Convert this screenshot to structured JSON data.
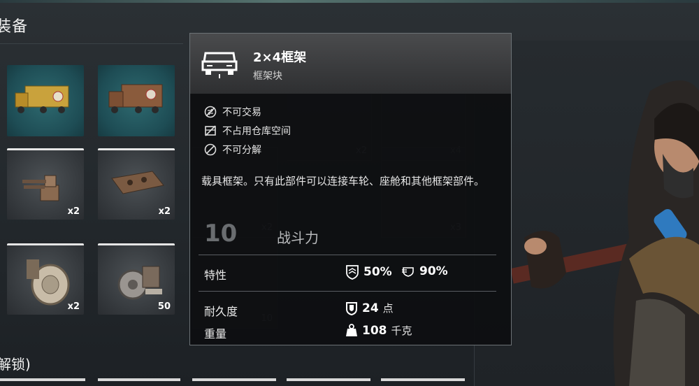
{
  "header": {
    "title": "装备"
  },
  "section": {
    "title": "解锁)"
  },
  "inventory": {
    "slots": [
      {
        "name": "truck-yellow",
        "count": ""
      },
      {
        "name": "truck-brown",
        "count": ""
      },
      {
        "name": "turret",
        "count": "x2"
      },
      {
        "name": "frame-part",
        "count": "x2"
      },
      {
        "name": "wheel",
        "count": "x2"
      },
      {
        "name": "scrap-parts",
        "count": "50"
      }
    ]
  },
  "background_slots": [
    {
      "count": "x2"
    },
    {
      "count": "x4"
    },
    {
      "count": "x2"
    },
    {
      "count": "x3"
    },
    {
      "count": "10"
    }
  ],
  "tooltip": {
    "name": "2×4框架",
    "subtitle": "框架块",
    "properties": [
      {
        "icon": "no-trade-icon",
        "label": "不可交易"
      },
      {
        "icon": "no-storage-icon",
        "label": "不占用仓库空间"
      },
      {
        "icon": "no-dismantle-icon",
        "label": "不可分解"
      }
    ],
    "description": "载具框架。只有此部件可以连接车轮、座舱和其他框架部件。",
    "power": {
      "value": "10",
      "label": "战斗力"
    },
    "traits": {
      "label": "特性",
      "stat1": "50%",
      "stat2": "90%"
    },
    "durability": {
      "label": "耐久度",
      "value": "24",
      "unit": "点"
    },
    "weight": {
      "label": "重量",
      "value": "108",
      "unit": "千克"
    }
  },
  "colors": {
    "tooltip_bg": "#0e0f11",
    "teal_slot": "#1e4d55",
    "accent_white": "#ffffff"
  }
}
